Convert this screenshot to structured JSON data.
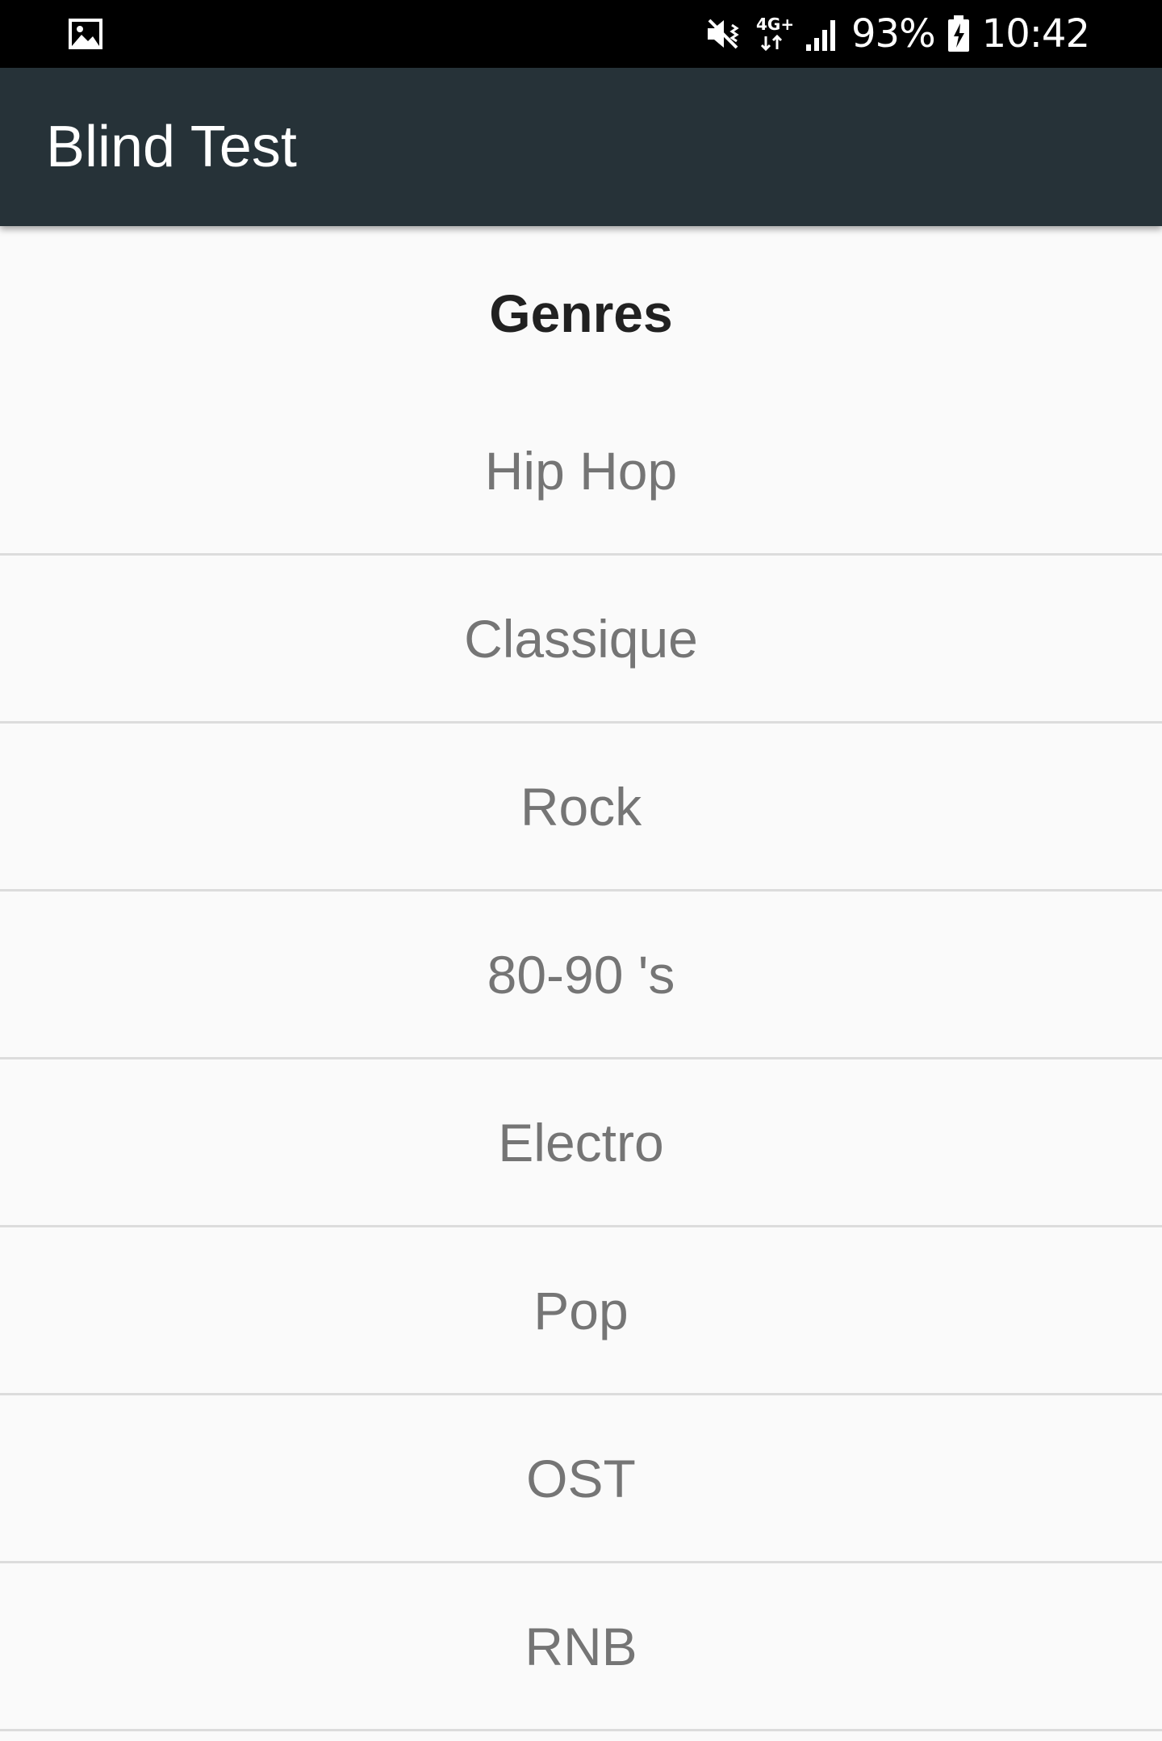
{
  "status_bar": {
    "left_icon": "image-notification-icon",
    "icons": [
      "vibrate-mute-icon",
      "network-4g-plus-icon",
      "signal-strength-icon",
      "battery-charging-icon"
    ],
    "battery_percent": "93%",
    "time": "10:42"
  },
  "app_bar": {
    "title": "Blind Test",
    "background_color": "#263238"
  },
  "main": {
    "section_title": "Genres",
    "genres": [
      {
        "label": "Hip Hop"
      },
      {
        "label": "Classique"
      },
      {
        "label": "Rock"
      },
      {
        "label": "80-90 's"
      },
      {
        "label": "Electro"
      },
      {
        "label": "Pop"
      },
      {
        "label": "OST"
      },
      {
        "label": "RNB"
      }
    ]
  }
}
